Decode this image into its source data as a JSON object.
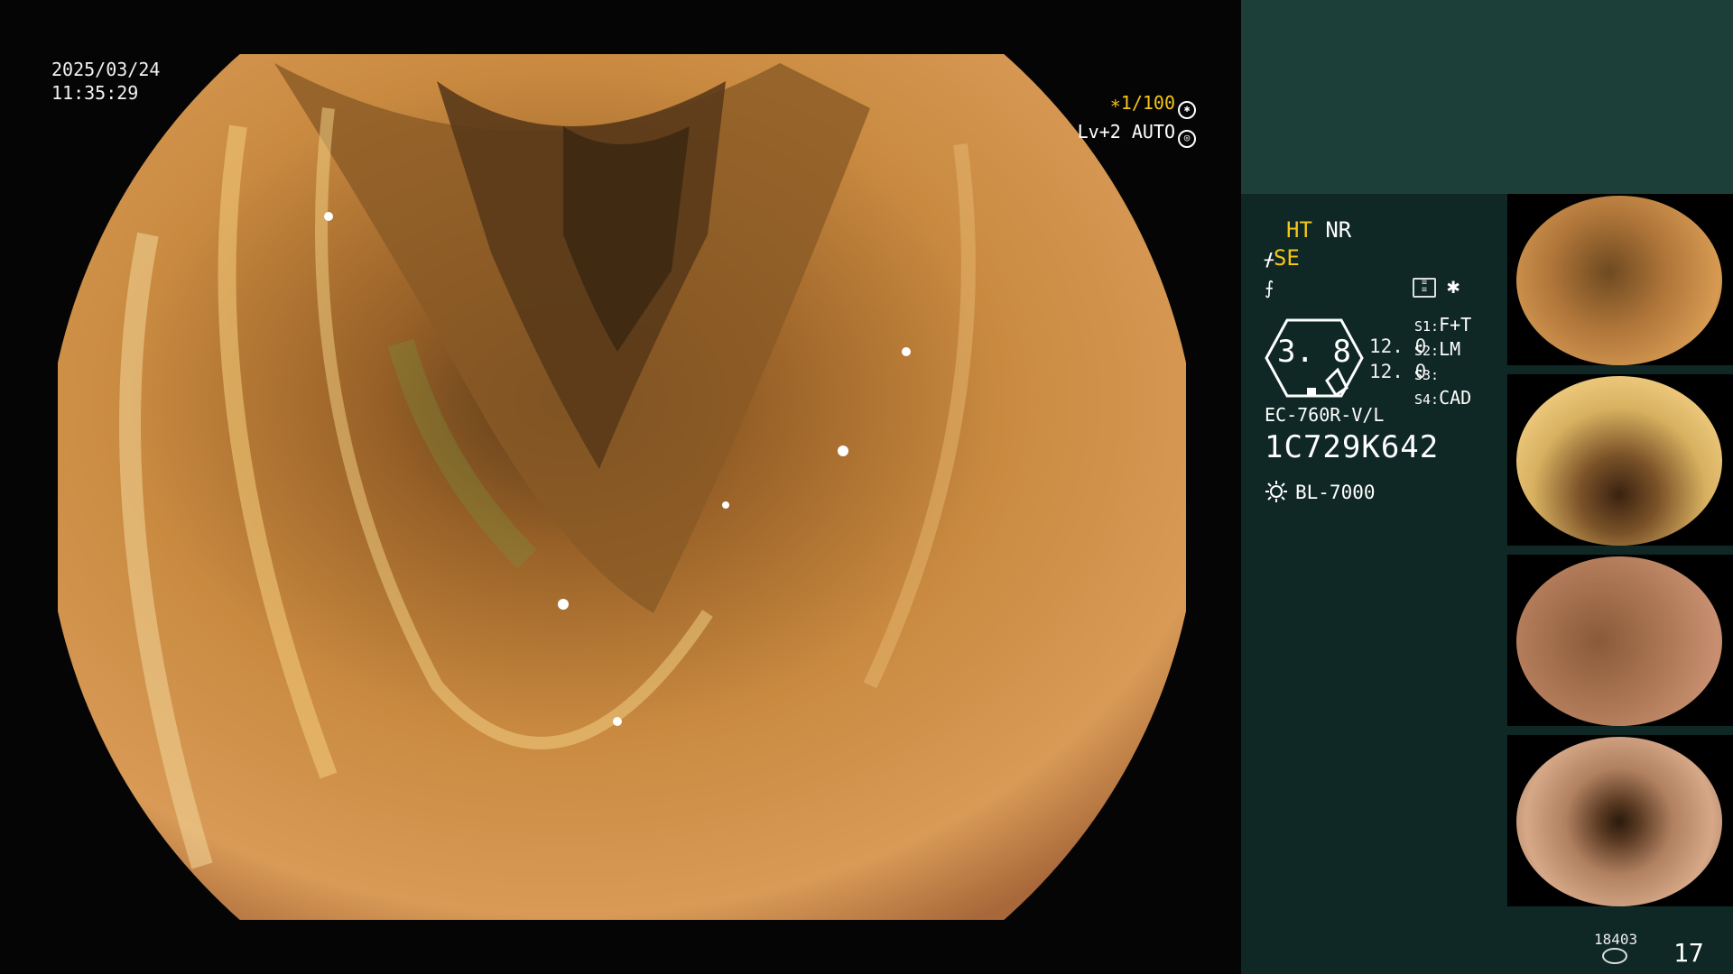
{
  "overlay": {
    "date": "2025/03/24",
    "time": "11:35:29",
    "shutter": "∗1/100",
    "level": "Lv+2 AUTO"
  },
  "panel": {
    "ht": "HT",
    "nr": "NR",
    "se": "SE",
    "hex_value": "3. 8",
    "value_1": "12. 0",
    "value_2": "12. 0",
    "slots": [
      {
        "key": "S1:",
        "val": "F+T"
      },
      {
        "key": "S2:",
        "val": "LM"
      },
      {
        "key": "S3:",
        "val": ""
      },
      {
        "key": "S4:",
        "val": "CAD"
      }
    ],
    "model": "EC-760R-V/L",
    "serial": "1C729K642",
    "light": "BL-7000"
  },
  "footer": {
    "counter": "18403",
    "page": "17"
  },
  "colors": {
    "panel_bg": "#0f2825",
    "top_band": "#1d3f3a",
    "highlight": "#f5c518"
  }
}
